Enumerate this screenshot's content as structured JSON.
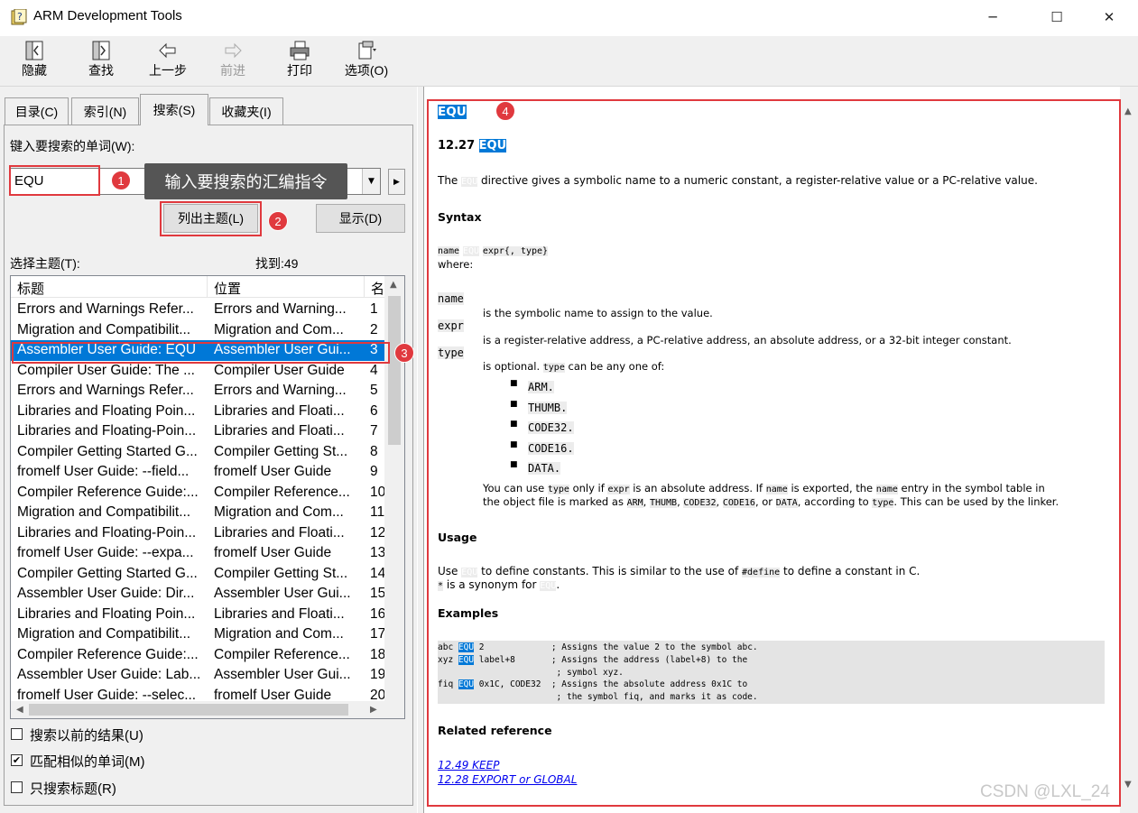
{
  "window": {
    "title": "ARM Development Tools",
    "minimize": "─",
    "maximize": "☐",
    "close": "✕"
  },
  "toolbar": {
    "hide": "隐藏",
    "find": "查找",
    "back": "上一步",
    "forward": "前进",
    "print": "打印",
    "options": "选项(O)"
  },
  "tabs": {
    "contents": "目录(C)",
    "index": "索引(N)",
    "search": "搜索(S)",
    "favorites": "收藏夹(I)"
  },
  "search": {
    "prompt": "键入要搜索的单词(W):",
    "keyword": "EQU",
    "list_topics": "列出主题(L)",
    "display": "显示(D)",
    "select_topic": "选择主题(T):",
    "found": "找到:49"
  },
  "list": {
    "headers": [
      "标题",
      "位置",
      "名"
    ],
    "rows": [
      [
        "Errors and Warnings Refer...",
        "Errors and Warning...",
        "1"
      ],
      [
        "Migration and Compatibilit...",
        "Migration and Com...",
        "2"
      ],
      [
        "Assembler User Guide: EQU",
        "Assembler User Gui...",
        "3"
      ],
      [
        "Compiler User Guide: The ...",
        "Compiler User Guide",
        "4"
      ],
      [
        "Errors and Warnings Refer...",
        "Errors and Warning...",
        "5"
      ],
      [
        "Libraries and Floating Poin...",
        "Libraries and Floati...",
        "6"
      ],
      [
        "Libraries and Floating-Poin...",
        "Libraries and Floati...",
        "7"
      ],
      [
        "Compiler Getting Started G...",
        "Compiler Getting St...",
        "8"
      ],
      [
        "fromelf User Guide: --field...",
        "fromelf User Guide",
        "9"
      ],
      [
        "Compiler Reference Guide:...",
        "Compiler Reference...",
        "10"
      ],
      [
        "Migration and Compatibilit...",
        "Migration and Com...",
        "11"
      ],
      [
        "Libraries and Floating-Poin...",
        "Libraries and Floati...",
        "12"
      ],
      [
        "fromelf User Guide: --expa...",
        "fromelf User Guide",
        "13"
      ],
      [
        "Compiler Getting Started G...",
        "Compiler Getting St...",
        "14"
      ],
      [
        "Assembler User Guide: Dir...",
        "Assembler User Gui...",
        "15"
      ],
      [
        "Libraries and Floating Poin...",
        "Libraries and Floati...",
        "16"
      ],
      [
        "Migration and Compatibilit...",
        "Migration and Com...",
        "17"
      ],
      [
        "Compiler Reference Guide:...",
        "Compiler Reference...",
        "18"
      ],
      [
        "Assembler User Guide: Lab...",
        "Assembler User Gui...",
        "19"
      ],
      [
        "fromelf User Guide: --selec...",
        "fromelf User Guide",
        "20"
      ]
    ],
    "selected_index": 2
  },
  "options": {
    "search_previous": "搜索以前的结果(U)",
    "match_similar": "匹配相似的单词(M)",
    "titles_only": "只搜索标题(R)",
    "search_previous_checked": false,
    "match_similar_checked": true,
    "titles_only_checked": false
  },
  "annotations": {
    "badge1": "1",
    "badge2": "2",
    "badge3": "3",
    "badge4": "4",
    "tooltip": "输入要搜索的汇编指令"
  },
  "doc": {
    "top_title": "EQU",
    "section_no": "12.27",
    "section_kw": "EQU",
    "intro_pre": "The",
    "intro_kw": "EQU",
    "intro_post": "directive gives a symbolic name to a numeric constant, a register-relative value or a PC-relative value.",
    "syntax_h": "Syntax",
    "syntax_name": "name",
    "syntax_kw": "EQU",
    "syntax_rest": "expr{, type}",
    "where": "where:",
    "defs": [
      {
        "term": "name",
        "desc": "is the symbolic name to assign to the value."
      },
      {
        "term": "expr",
        "desc": "is a register-relative address, a PC-relative address, an absolute address, or a 32-bit integer constant."
      },
      {
        "term": "type",
        "desc_pre": "is optional.",
        "desc_code": "type",
        "desc_post": "can be any one of:"
      }
    ],
    "types": [
      "ARM.",
      "THUMB.",
      "CODE32.",
      "CODE16.",
      "DATA."
    ],
    "note1_a": "You can use",
    "note1_b": "type",
    "note1_c": "only if",
    "note1_d": "expr",
    "note1_e": "is an absolute address. If",
    "note1_f": "name",
    "note1_g": "is exported, the",
    "note1_h": "name",
    "note1_i": "entry in the symbol table in",
    "note2_a": "the object file is marked as",
    "note2_b": "ARM",
    "note2_c": "THUMB",
    "note2_d": "CODE32",
    "note2_e": "CODE16",
    "note2_f": "DATA",
    "note2_g": ", according to",
    "note2_h": "type",
    "note2_i": ". This can be used by the linker.",
    "usage_h": "Usage",
    "usage1_a": "Use",
    "usage1_b": "EQU",
    "usage1_c": "to define constants. This is similar to the use of",
    "usage1_d": "#define",
    "usage1_e": "to define a constant in C.",
    "usage2_a": "*",
    "usage2_b": "is a synonym for",
    "usage2_c": "EQU",
    "usage2_d": ".",
    "examples_h": "Examples",
    "code": [
      {
        "a": "abc ",
        "kw": "EQU",
        "b": " 2             ; Assigns the value 2 to the symbol abc."
      },
      {
        "a": "xyz ",
        "kw": "EQU",
        "b": " label+8       ; Assigns the address (label+8) to the"
      },
      {
        "a": "",
        "kw": "",
        "b": "                       ; symbol xyz."
      },
      {
        "a": "fiq ",
        "kw": "EQU",
        "b": " 0x1C, CODE32  ; Assigns the absolute address 0x1C to"
      },
      {
        "a": "",
        "kw": "",
        "b": "                       ; the symbol fiq, and marks it as code."
      }
    ],
    "related_h": "Related reference",
    "link1": "12.49 KEEP",
    "link2": "12.28 EXPORT or GLOBAL"
  },
  "watermark": "CSDN @LXL_24",
  "colors": {
    "selection": "#0078d7",
    "annotation_red": "#e0393e",
    "link": "#0000ee"
  }
}
